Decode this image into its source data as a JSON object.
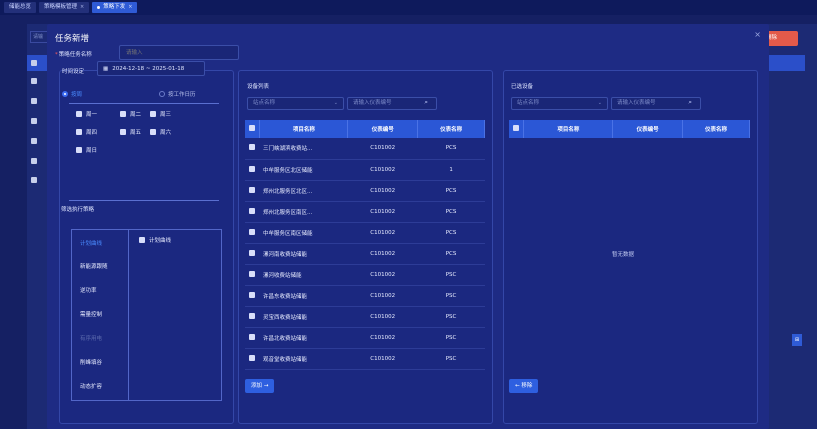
{
  "tabs": [
    {
      "label": "储能总览",
      "active": false,
      "closable": false
    },
    {
      "label": "策略模板管理",
      "active": false,
      "closable": true
    },
    {
      "label": "策略下发",
      "active": true,
      "closable": true
    }
  ],
  "background": {
    "search_stub": "请输",
    "red_button": "删除",
    "side_tab": "⊞"
  },
  "modal": {
    "title": "任务新增",
    "close_icon": "×",
    "task_name_label": "策略任务名称",
    "task_name_placeholder": "请输入"
  },
  "config": {
    "time_label": "时间设定",
    "date_range": "2024-12-18 ~ 2025-01-18",
    "radio_week": "按周",
    "radio_calendar": "按工作日历",
    "weekdays": [
      "周一",
      "周二",
      "周三",
      "周四",
      "周五",
      "周六",
      "周日"
    ],
    "strategy_title": "筛选执行策略",
    "strategies": [
      {
        "label": "计划曲线",
        "state": "active"
      },
      {
        "label": "新能源跟随",
        "state": "normal"
      },
      {
        "label": "逆功率",
        "state": "normal"
      },
      {
        "label": "需量控制",
        "state": "normal"
      },
      {
        "label": "有序用电",
        "state": "disabled"
      },
      {
        "label": "削峰填谷",
        "state": "normal"
      },
      {
        "label": "动态扩容",
        "state": "normal"
      }
    ],
    "strategy_option": "计划曲线"
  },
  "device_list": {
    "title": "设备列表",
    "station_placeholder": "站点名称",
    "meter_placeholder": "请输入仪表编号",
    "columns": [
      "项目名称",
      "仪表编号",
      "仪表名称"
    ],
    "rows": [
      [
        "三门峡湖滨收费站...",
        "C101002",
        "PCS"
      ],
      [
        "中牟服务区北区储能",
        "C101002",
        "1"
      ],
      [
        "郑州北服务区北区...",
        "C101002",
        "PCS"
      ],
      [
        "郑州北服务区南区...",
        "C101002",
        "PCS"
      ],
      [
        "中牟服务区南区储能",
        "C101002",
        "PCS"
      ],
      [
        "漯河南收费站储能",
        "C101002",
        "PCS"
      ],
      [
        "漯河收费站储能",
        "C101002",
        "PSC"
      ],
      [
        "许昌东收费站储能",
        "C101002",
        "PSC"
      ],
      [
        "灵宝西收费站储能",
        "C101002",
        "PSC"
      ],
      [
        "许昌北收费站储能",
        "C101002",
        "PSC"
      ],
      [
        "观音堂收费站储能",
        "C101002",
        "PSC"
      ]
    ],
    "add_button": "添加 →"
  },
  "selected": {
    "title": "已选设备",
    "station_placeholder": "站点名称",
    "meter_placeholder": "请输入仪表编号",
    "columns": [
      "项目名称",
      "仪表编号",
      "仪表名称"
    ],
    "empty_text": "暂无数据",
    "remove_button": "← 移除"
  }
}
